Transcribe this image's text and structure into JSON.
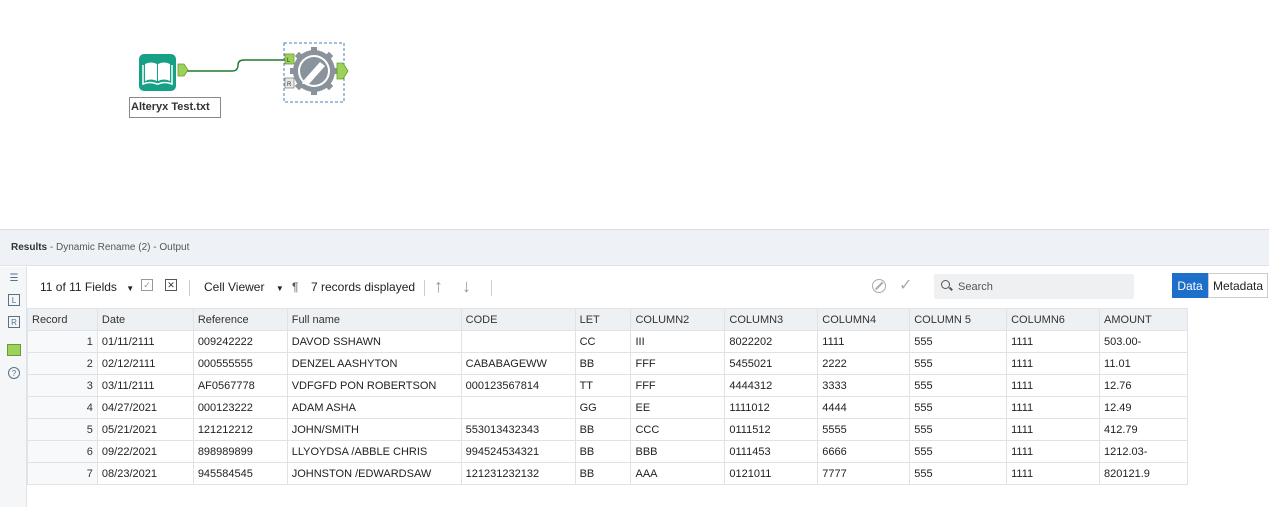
{
  "canvas": {
    "input_tool_label": "Alteryx Test.txt",
    "left_anchor": "L",
    "right_anchor": "R",
    "colors": {
      "input_tool": "#16a085",
      "connector": "#1e7a2e",
      "anchor": "#9bd35a"
    }
  },
  "results": {
    "title": "Results",
    "subtitle": " - Dynamic Rename (2) - Output"
  },
  "toolbar": {
    "fields_label": "11 of 11 Fields",
    "cell_viewer_label": "Cell Viewer",
    "pilcrow": "¶",
    "records_label": "7 records displayed",
    "search_placeholder": "Search",
    "data_tab": "Data",
    "metadata_tab": "Metadata"
  },
  "table": {
    "columns": [
      "Record",
      "Date",
      "Reference",
      "Full name",
      "CODE",
      "LET",
      "COLUMN2",
      "COLUMN3",
      "COLUMN4",
      "COLUMN 5",
      "COLUMN6",
      "AMOUNT"
    ],
    "rows": [
      [
        "1",
        "01/11/2111",
        "009242222",
        "DAVOD SSHAWN",
        "",
        "CC",
        "III",
        "8022202",
        "1111",
        "555",
        "1111",
        "503.00-"
      ],
      [
        "2",
        "02/12/2111",
        "000555555",
        "DENZEL AASHYTON",
        "CABABAGEWW",
        "BB",
        "FFF",
        "5455021",
        "2222",
        "555",
        "1111",
        "11.01"
      ],
      [
        "3",
        "03/11/2111",
        "AF0567778",
        "VDFGFD PON ROBERTSON",
        "000123567814",
        "TT",
        "FFF",
        "4444312",
        "3333",
        "555",
        "1111",
        "12.76"
      ],
      [
        "4",
        "04/27/2021",
        "000123222",
        "ADAM ASHA",
        "",
        "GG",
        "EE",
        "1111012",
        "4444",
        "555",
        "1111",
        "12.49"
      ],
      [
        "5",
        "05/21/2021",
        "121212212",
        "JOHN/SMITH",
        "553013432343",
        "BB",
        "CCC",
        "0111512",
        "5555",
        "555",
        "1111",
        "412.79"
      ],
      [
        "6",
        "09/22/2021",
        "898989899",
        "LLYOYDSA /ABBLE  CHRIS",
        "994524534321",
        "BB",
        "BBB",
        "0111453",
        "6666",
        "555",
        "1111",
        "1212.03-"
      ],
      [
        "7",
        "08/23/2021",
        "945584545",
        "JOHNSTON /EDWARDSAW",
        "121231232132",
        "BB",
        "AAA",
        "0121011",
        "7777",
        "555",
        "1111",
        "820121.9"
      ]
    ]
  }
}
